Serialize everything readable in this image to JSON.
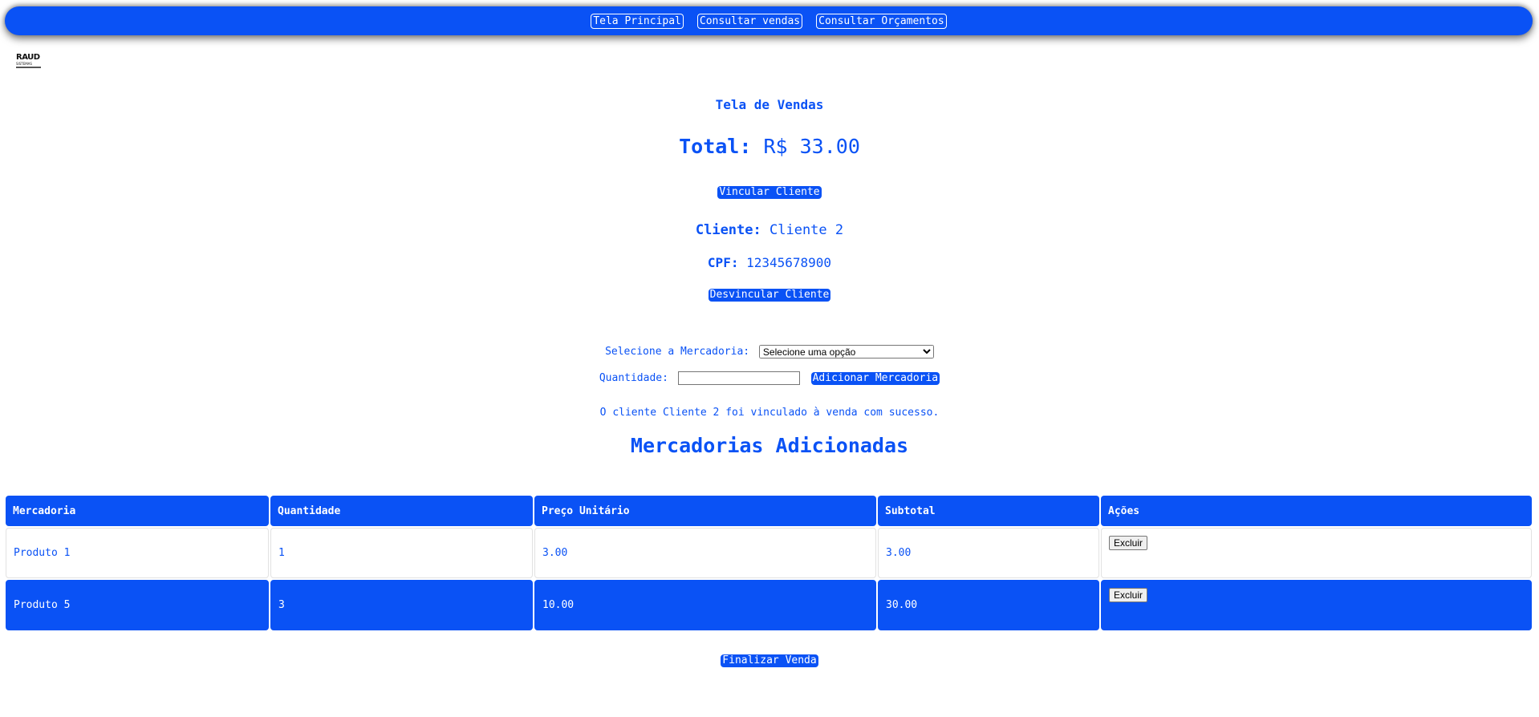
{
  "nav": {
    "items": [
      "Tela Principal",
      "Consultar vendas",
      "Consultar Orçamentos"
    ]
  },
  "logo": {
    "name": "RAUD",
    "subtitle": "SISTEMAS"
  },
  "page": {
    "title": "Tela de Vendas",
    "total_label": "Total:",
    "total_value": "R$ 33.00",
    "link_client_button": "Vincular Cliente",
    "client_label": "Cliente:",
    "client_value": "Cliente 2",
    "cpf_label": "CPF:",
    "cpf_value": "12345678900",
    "unlink_client_button": "Desvincular Cliente"
  },
  "form": {
    "merchandise_label": "Selecione a Mercadoria:",
    "merchandise_selected": "Selecione uma opção",
    "quantity_label": "Quantidade:",
    "quantity_value": "",
    "add_button": "Adicionar Mercadoria"
  },
  "message": "O cliente Cliente 2 foi vinculado à venda com sucesso.",
  "added_section": {
    "title": "Mercadorias Adicionadas",
    "columns": [
      "Mercadoria",
      "Quantidade",
      "Preço Unitário",
      "Subtotal",
      "Ações"
    ],
    "rows": [
      {
        "mercadoria": "Produto 1",
        "quantidade": "1",
        "preco": "3.00",
        "subtotal": "3.00",
        "acao": "Excluir"
      },
      {
        "mercadoria": "Produto 5",
        "quantidade": "3",
        "preco": "10.00",
        "subtotal": "30.00",
        "acao": "Excluir"
      }
    ]
  },
  "finish_button": "Finalizar Venda",
  "colors": {
    "accent": "#0a52f5",
    "background": "#ffffff"
  }
}
